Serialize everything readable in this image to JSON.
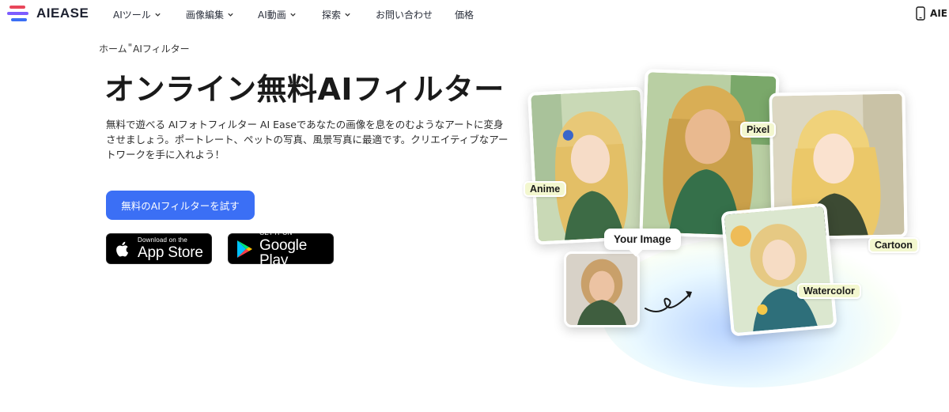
{
  "nav": {
    "logo_text": "AIEASE",
    "items": [
      {
        "label": "AIツール",
        "has_dropdown": true
      },
      {
        "label": "画像編集",
        "has_dropdown": true
      },
      {
        "label": "AI動画",
        "has_dropdown": true
      },
      {
        "label": "探索",
        "has_dropdown": true
      },
      {
        "label": "お問い合わせ",
        "has_dropdown": false
      },
      {
        "label": "価格",
        "has_dropdown": false
      }
    ],
    "right_label": "AIE",
    "right_icon": "smartphone-icon"
  },
  "breadcrumb": {
    "home": "ホーム",
    "separator": "\"",
    "current": "AIフィルター"
  },
  "hero": {
    "title": "オンライン無料AIフィルター",
    "description": "無料で遊べる AIフォトフィルター AI Easeであなたの画像を息をのむようなアートに変身させましょう。ポートレート、ペットの写真、風景写真に最適です。クリエイティブなアートワークを手に入れよう！",
    "cta_label": "無料のAIフィルターを試す"
  },
  "stores": {
    "apple": {
      "small": "Download on the",
      "big": "App Store",
      "icon": "apple-icon"
    },
    "google": {
      "small": "GET IT ON",
      "big": "Google Play",
      "icon": "google-play-icon"
    }
  },
  "collage": {
    "labels": {
      "anime": "Anime",
      "pixel": "Pixel",
      "cartoon": "Cartoon",
      "your_image": "Your Image",
      "watercolor": "Watercolor"
    }
  },
  "colors": {
    "accent": "#3b6ff5",
    "tag_bg": "#f3f7cf",
    "logo_red": "#e8465a",
    "logo_blue": "#3b6ff5"
  }
}
